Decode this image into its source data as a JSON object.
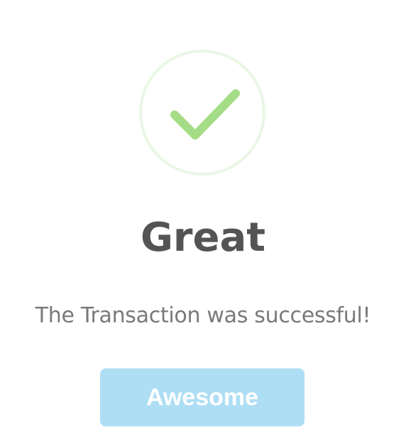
{
  "dialog": {
    "icon": "checkmark-icon",
    "title": "Great",
    "message": "The Transaction was successful!",
    "confirm_label": "Awesome"
  },
  "colors": {
    "check": "#a5dc86",
    "ring": "#e9f7e5",
    "title": "#545454",
    "message": "#797979",
    "button": "#aedef4",
    "button_text": "#ffffff"
  }
}
